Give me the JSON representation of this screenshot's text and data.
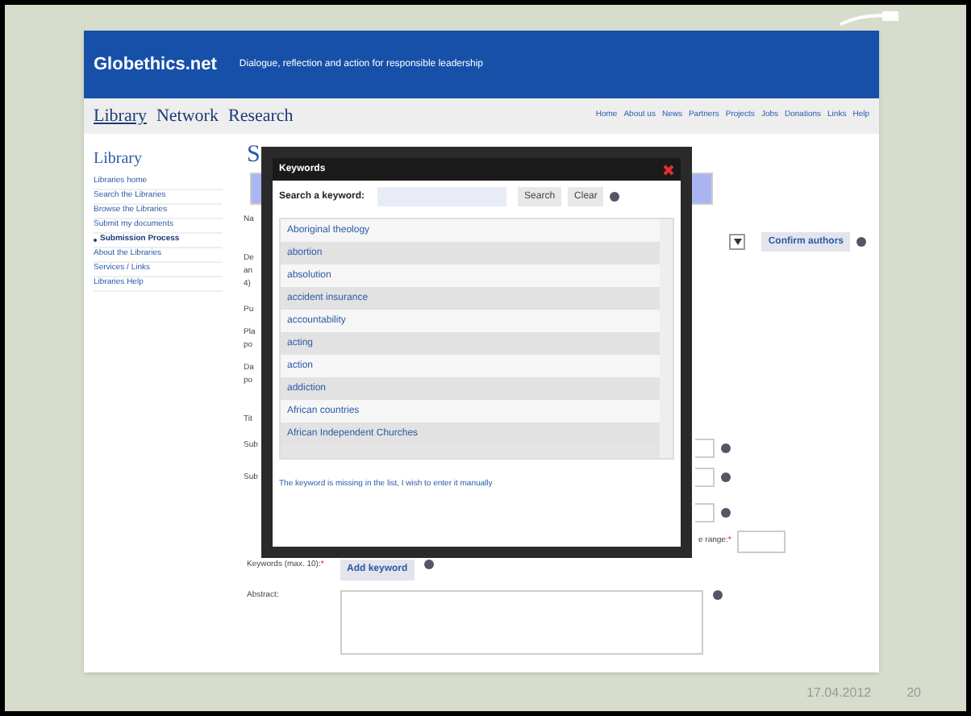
{
  "header": {
    "logo": "Globethics.net",
    "tagline": "Dialogue, reflection and action for responsible leadership"
  },
  "main_nav": [
    {
      "label": "Library",
      "selected": true
    },
    {
      "label": "Network",
      "selected": false
    },
    {
      "label": "Research",
      "selected": false
    }
  ],
  "top_links": [
    "Home",
    "About us",
    "News",
    "Partners",
    "Projects",
    "Jobs",
    "Donations",
    "Links",
    "Help"
  ],
  "sidebar": {
    "title": "Library",
    "items": [
      {
        "label": "Libraries home",
        "selected": false
      },
      {
        "label": "Search the Libraries",
        "selected": false
      },
      {
        "label": "Browse the Libraries",
        "selected": false
      },
      {
        "label": "Submit my documents",
        "selected": false
      },
      {
        "label": "Submission Process",
        "selected": true
      },
      {
        "label": "About the Libraries",
        "selected": false
      },
      {
        "label": "Services / Links",
        "selected": false
      },
      {
        "label": "Libraries Help",
        "selected": false
      }
    ]
  },
  "page_title": "S",
  "form": {
    "partial_labels": [
      "Na",
      "De",
      "an",
      "4)",
      "Pu",
      "Pla",
      "po",
      "Da",
      "po",
      "Tit",
      "Sub",
      "Sub"
    ],
    "confirm_button": "Confirm authors",
    "range_label": "e range:",
    "range_required": "*",
    "keywords_label": "Keywords (max. 10):",
    "keywords_required": "*",
    "add_keyword_button": "Add keyword",
    "abstract_label": "Abstract:"
  },
  "dialog": {
    "title": "Keywords",
    "search_label": "Search a keyword:",
    "search_button": "Search",
    "clear_button": "Clear",
    "keywords": [
      "Aboriginal theology",
      "abortion",
      "absolution",
      "accident insurance",
      "accountability",
      "acting",
      "action",
      "addiction",
      "African countries",
      "African Independent Churches"
    ],
    "manual_link": "The keyword is missing in the list, I wish to enter it manually"
  },
  "footer": {
    "date": "17.04.2012",
    "page": "20"
  }
}
